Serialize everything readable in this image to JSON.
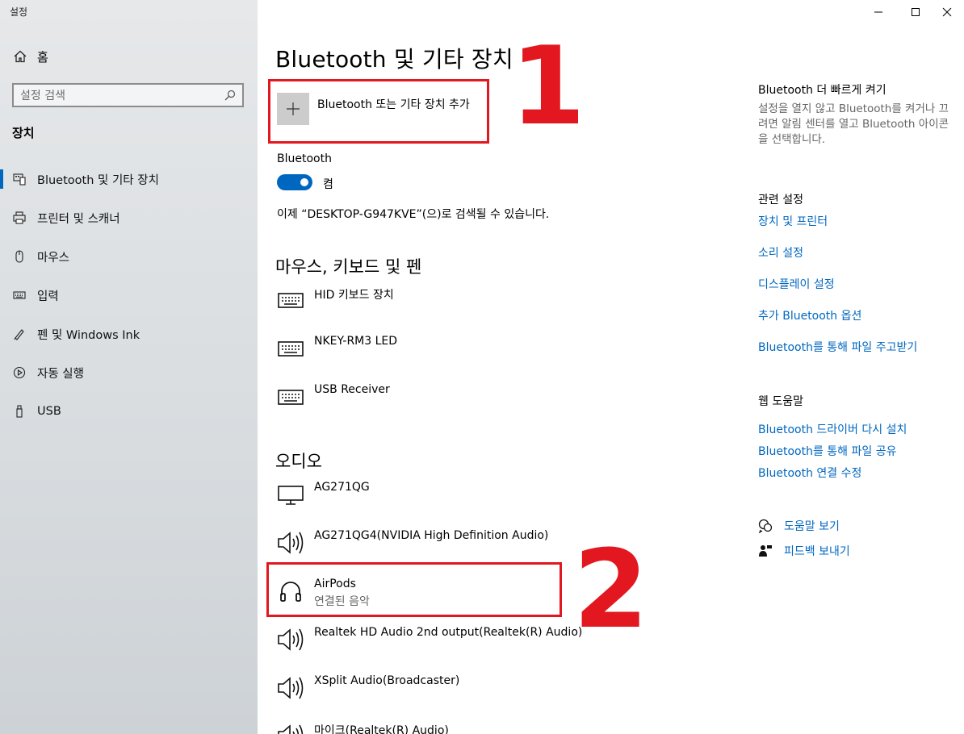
{
  "window": {
    "title": "설정"
  },
  "sidebar": {
    "home_label": "홈",
    "search_placeholder": "설정 검색",
    "section": "장치",
    "items": [
      {
        "label": "Bluetooth 및 기타 장치",
        "icon": "bluetooth-devices-icon",
        "active": true
      },
      {
        "label": "프린터 및 스캐너",
        "icon": "printer-icon"
      },
      {
        "label": "마우스",
        "icon": "mouse-icon"
      },
      {
        "label": "입력",
        "icon": "keyboard-icon"
      },
      {
        "label": "펜 및 Windows Ink",
        "icon": "pen-icon"
      },
      {
        "label": "자동 실행",
        "icon": "autoplay-icon"
      },
      {
        "label": "USB",
        "icon": "usb-icon"
      }
    ]
  },
  "main": {
    "title": "Bluetooth 및 기타 장치",
    "add_device_label": "Bluetooth 또는 기타 장치 추가",
    "bluetooth_label": "Bluetooth",
    "toggle_state": "켬",
    "discoverable_text": "이제 “DESKTOP-G947KVE”(으)로 검색될 수 있습니다.",
    "input_section": {
      "title": "마우스, 키보드 및 펜",
      "devices": [
        {
          "name": "HID 키보드 장치",
          "icon": "keyboard-icon"
        },
        {
          "name": "NKEY-RM3 LED",
          "icon": "keyboard-icon"
        },
        {
          "name": "USB Receiver",
          "icon": "keyboard-icon"
        }
      ]
    },
    "audio_section": {
      "title": "오디오",
      "devices": [
        {
          "name": "AG271QG",
          "icon": "monitor-icon"
        },
        {
          "name": "AG271QG4(NVIDIA High Definition Audio)",
          "icon": "speaker-icon"
        },
        {
          "name": "AirPods",
          "status": "연결된 음악",
          "icon": "headphones-icon"
        },
        {
          "name": "Realtek HD Audio 2nd output(Realtek(R) Audio)",
          "icon": "speaker-icon"
        },
        {
          "name": "XSplit Audio(Broadcaster)",
          "icon": "speaker-icon"
        },
        {
          "name": "마이크(Realtek(R) Audio)",
          "icon": "speaker-icon"
        }
      ]
    },
    "annotations": [
      "1",
      "2"
    ]
  },
  "right": {
    "faster_title": "Bluetooth 더 빠르게 켜기",
    "faster_text": "설정을 열지 않고 Bluetooth를 켜거나 끄려면 알림 센터를 열고 Bluetooth 아이콘을 선택합니다.",
    "related_title": "관련 설정",
    "related_links": [
      "장치 및 프린터",
      "소리 설정",
      "디스플레이 설정",
      "추가 Bluetooth 옵션",
      "Bluetooth를 통해 파일 주고받기"
    ],
    "web_help_title": "웹 도움말",
    "web_help_links": [
      "Bluetooth 드라이버 다시 설치",
      "Bluetooth를 통해 파일 공유",
      "Bluetooth 연결 수정"
    ],
    "get_help": "도움말 보기",
    "feedback": "피드백 보내기"
  },
  "colors": {
    "accent": "#0067c0",
    "annotation": "#e3171f"
  }
}
